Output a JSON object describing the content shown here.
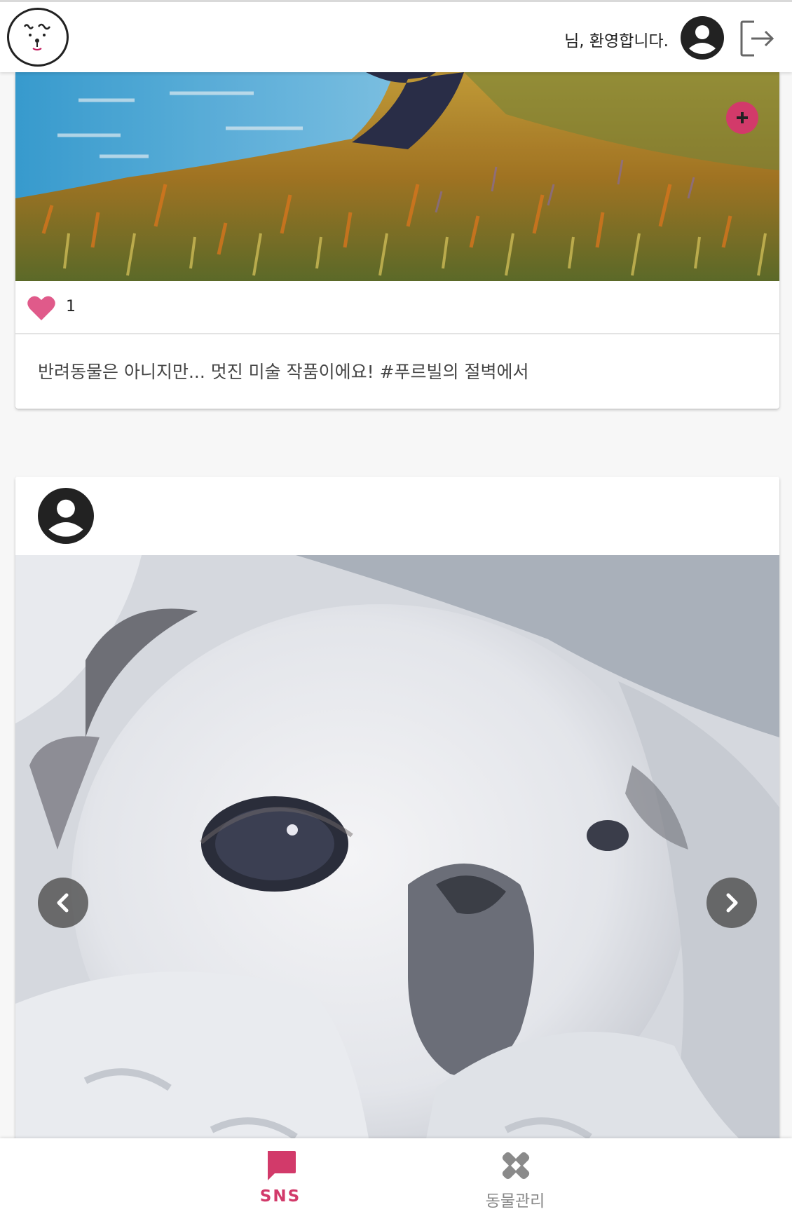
{
  "header": {
    "welcome_text": "님, 환영합니다."
  },
  "post1": {
    "like_count": "1",
    "caption": "반려동물은 아니지만... 멋진 미술 작품이에요! #푸르빌의 절벽에서"
  },
  "bottom_nav": {
    "items": [
      {
        "label": "SNS",
        "icon": "chat-bubble-icon",
        "active": true
      },
      {
        "label": "동물관리",
        "icon": "bandage-icon",
        "active": false
      }
    ]
  },
  "colors": {
    "accent": "#d23a6a",
    "inactive": "#888888",
    "avatar": "#222222"
  }
}
